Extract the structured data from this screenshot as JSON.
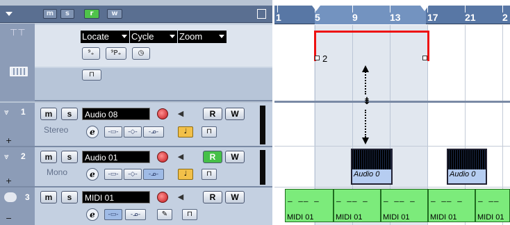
{
  "filters": [
    "m",
    "s",
    "r",
    "w"
  ],
  "filter_active": "r",
  "global": {
    "locate": "Locate",
    "cycle": "Cycle",
    "zoom": "Zoom",
    "marker_buttons": [
      "⁹₊",
      "⁹P₊",
      "◷"
    ],
    "lock_icon": "⊓"
  },
  "ruler": {
    "bars": [
      "1",
      "5",
      "9",
      "13",
      "17",
      "21",
      "2"
    ]
  },
  "marker_label": "2",
  "tracks": [
    {
      "num": "1",
      "name": "Audio 08",
      "type_label": "Stereo",
      "r_active": false
    },
    {
      "num": "2",
      "name": "Audio 01",
      "type_label": "Mono",
      "r_active": true
    },
    {
      "num": "3",
      "name": "MIDI 01",
      "type_label": "",
      "r_active": false
    }
  ],
  "buttons": {
    "mute": "m",
    "solo": "s",
    "read": "R",
    "write": "W",
    "edit": "e"
  },
  "audio_parts": [
    "Audio 0",
    "Audio 0"
  ],
  "midi_parts": [
    "MIDI 01",
    "MIDI 01",
    "MIDI 01",
    "MIDI 01",
    "MIDI 01"
  ],
  "colors": {
    "loop": "#ee1111",
    "active_green": "#45c048",
    "midi_part": "#7ceb7b"
  }
}
